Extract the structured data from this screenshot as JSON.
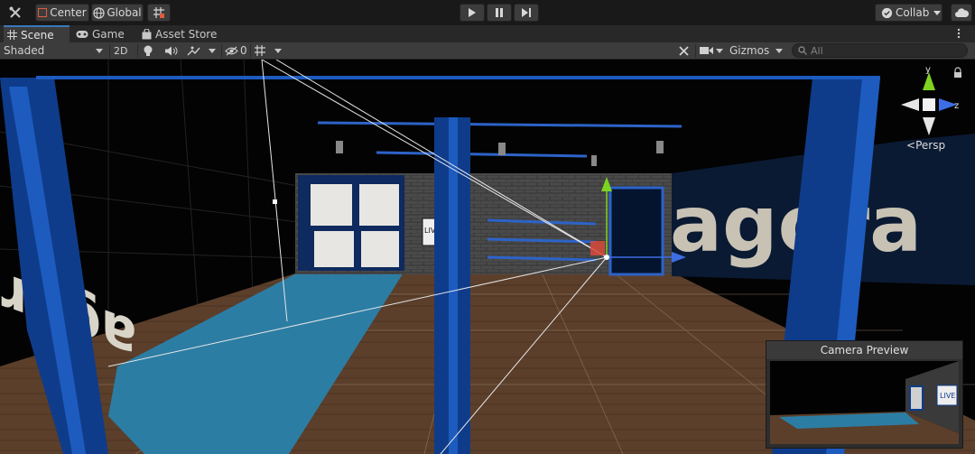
{
  "toolbar": {
    "pivot_label": "Center",
    "space_label": "Global",
    "collab_label": "Collab"
  },
  "tabs": [
    {
      "label": "Scene",
      "icon": "hash-grid-icon",
      "active": true
    },
    {
      "label": "Game",
      "icon": "gamepad-icon",
      "active": false
    },
    {
      "label": "Asset Store",
      "icon": "shopping-bag-icon",
      "active": false
    }
  ],
  "scene_toolbar": {
    "shading_mode": "Shaded",
    "mode_2d": "2D",
    "hidden_count": "0",
    "gizmos_label": "Gizmos",
    "search_placeholder": "All"
  },
  "scene": {
    "orientation_gizmo": {
      "y_label": "y",
      "z_label": "z",
      "projection_label": "Persp"
    },
    "floor_logo_text": "agora",
    "wall_logo_text": "agora",
    "sign_text": "LIVE"
  },
  "camera_preview": {
    "title": "Camera Preview",
    "sign_text": "LIVE"
  },
  "colors": {
    "accent_blue": "#3a79bb",
    "frame_blue": "#0f3c8a",
    "floor_brown": "#5a3e2b",
    "rug_blue": "#2b7fa6",
    "gizmo_green": "#7ed321",
    "gizmo_blue": "#3d6ee6",
    "gizmo_red": "#d84a3a"
  }
}
